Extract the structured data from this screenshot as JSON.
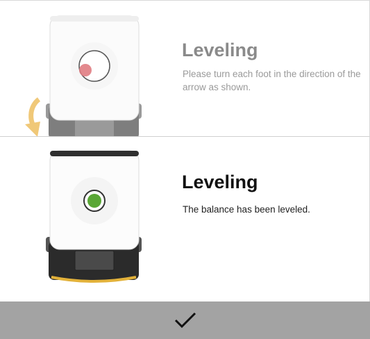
{
  "steps": [
    {
      "title": "Leveling",
      "description": "Please turn each foot in the direction of the arrow as shown.",
      "indicator_color": "#e07c82",
      "state": "adjusting"
    },
    {
      "title": "Leveling",
      "description": "The balance has been leveled.",
      "indicator_color": "#5aa736",
      "state": "leveled"
    }
  ],
  "footer": {
    "confirm_icon": "checkmark-icon",
    "background": "#a3a3a3"
  },
  "colors": {
    "arrow": "#f0c878",
    "accent_strip": "#e3b23a",
    "display_dark": "#2b2b2b"
  }
}
